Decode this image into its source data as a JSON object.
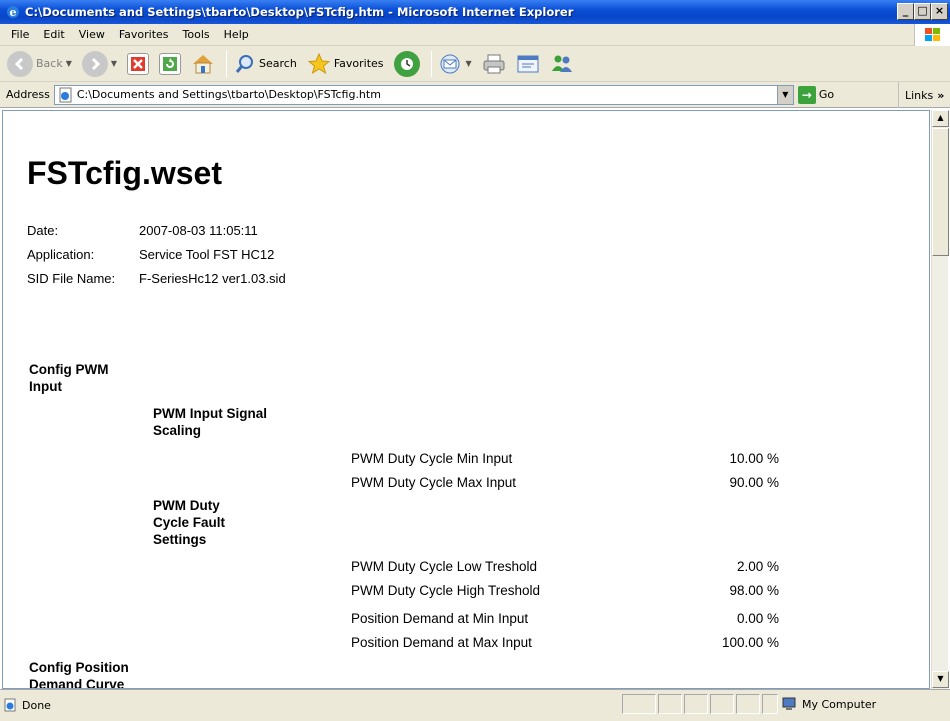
{
  "window": {
    "title": "C:\\Documents and Settings\\tbarto\\Desktop\\FSTcfig.htm - Microsoft Internet Explorer",
    "minimize_label": "_",
    "maximize_label": "□",
    "close_label": "×"
  },
  "menu": {
    "file": "File",
    "edit": "Edit",
    "view": "View",
    "favorites": "Favorites",
    "tools": "Tools",
    "help": "Help"
  },
  "toolbar": {
    "back": "Back",
    "search": "Search",
    "favorites": "Favorites"
  },
  "address": {
    "label": "Address",
    "value": "C:\\Documents and Settings\\tbarto\\Desktop\\FSTcfig.htm",
    "go": "Go",
    "links": "Links"
  },
  "page": {
    "title": "FSTcfig.wset",
    "meta": [
      {
        "key": "Date:",
        "value": "2007-08-03 11:05:11"
      },
      {
        "key": "Application:",
        "value": "Service Tool FST HC12"
      },
      {
        "key": "SID File Name:",
        "value": "F-SeriesHc12 ver1.03.sid"
      }
    ],
    "sections": {
      "config_pwm_input": "Config PWM Input",
      "pwm_input_signal_scaling": "PWM Input Signal Scaling",
      "pwm_duty_cycle_fault_settings": "PWM Duty Cycle Fault Settings",
      "config_position_demand_curve": "Config Position Demand Curve"
    },
    "params": [
      {
        "name": "PWM Duty Cycle Min Input",
        "value": "10.00 %"
      },
      {
        "name": "PWM Duty Cycle Max Input",
        "value": "90.00 %"
      },
      {
        "name": "PWM Duty Cycle Low Treshold",
        "value": "2.00 %"
      },
      {
        "name": "PWM Duty Cycle High Treshold",
        "value": "98.00 %"
      },
      {
        "name": "Position Demand at Min Input",
        "value": "0.00 %"
      },
      {
        "name": "Position Demand at Max Input",
        "value": "100.00 %"
      }
    ]
  },
  "status": {
    "text": "Done",
    "zone": "My Computer"
  }
}
